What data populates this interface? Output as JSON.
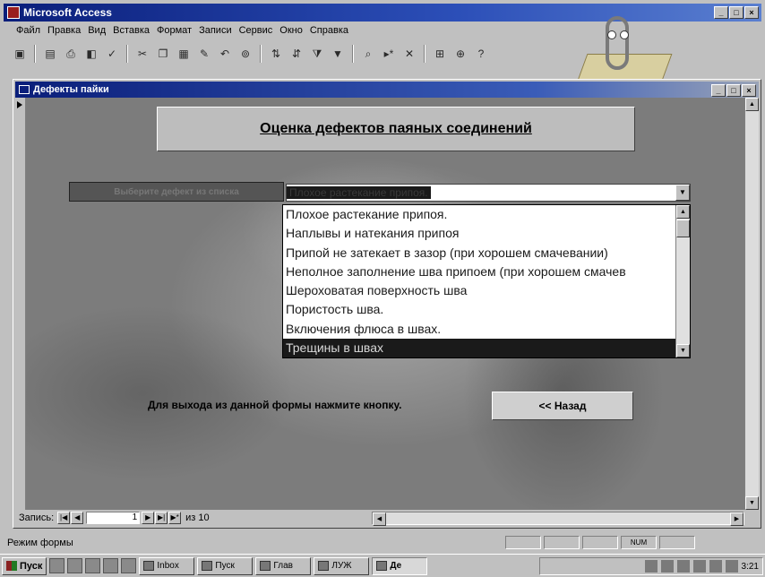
{
  "app": {
    "title": "Microsoft Access",
    "window_controls": [
      "_",
      "□",
      "×"
    ]
  },
  "menubar": {
    "items": [
      "Файл",
      "Правка",
      "Вид",
      "Вставка",
      "Формат",
      "Записи",
      "Сервис",
      "Окно",
      "Справка"
    ]
  },
  "toolbar": {
    "icons": [
      "view-icon",
      "save-icon",
      "print-icon",
      "print-preview-icon",
      "spelling-icon",
      "cut-icon",
      "copy-icon",
      "paste-icon",
      "format-painter-icon",
      "undo-icon",
      "hyperlink-icon",
      "sort-ascending-icon",
      "sort-descending-icon",
      "filter-by-selection-icon",
      "apply-filter-icon",
      "find-icon",
      "new-record-icon",
      "delete-record-icon",
      "database-window-icon",
      "new-object-icon",
      "help-icon"
    ]
  },
  "child_window": {
    "title": "Дефекты пайки",
    "window_controls": [
      "_",
      "□",
      "×"
    ]
  },
  "form": {
    "heading": "Оценка дефектов паяных соединений",
    "select_label": "Выберите дефект из списка",
    "combo_value": "Плохое растекание припоя.",
    "dropdown_items": [
      "Плохое растекание припоя.",
      "Наплывы и натекания припоя",
      "Припой не затекает в зазор (при хорошем смачевании)",
      "Неполное заполнение шва припоем (при хорошем смачев",
      "Шероховатая поверхность шва",
      "Пористость шва.",
      "Включения флюса в швах.",
      "Трещины в швах"
    ],
    "selected_index": 7,
    "exit_text": "Для выхода из данной формы нажмите кнопку.",
    "back_button": "<< Назад"
  },
  "navigation": {
    "label": "Запись:",
    "current_record": "1",
    "of_text": "из 10"
  },
  "statusbar": {
    "text": "Режим формы",
    "indicators": [
      "",
      "",
      "",
      "NUM",
      ""
    ]
  },
  "taskbar": {
    "start": "Пуск",
    "tasks": [
      "Inbox",
      "Пуск",
      "Глав",
      "ЛУЖ",
      "Де"
    ],
    "active_task_index": 4,
    "clock": "3:21"
  },
  "colors": {
    "title_bar": "#0a1e7a",
    "face": "#c0c0c0",
    "selection": "#1a1a1a"
  }
}
